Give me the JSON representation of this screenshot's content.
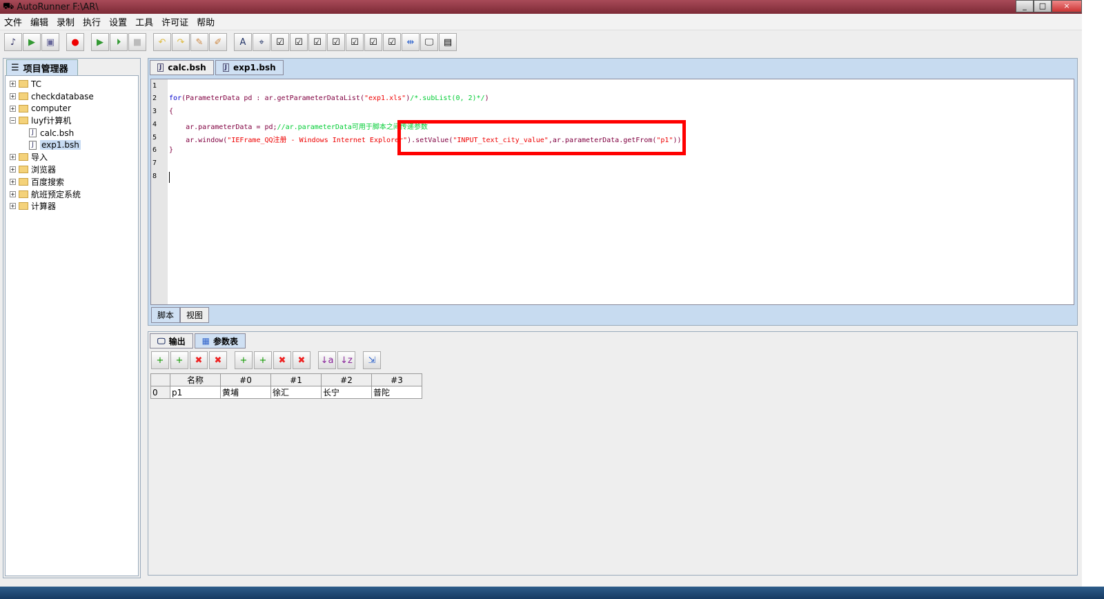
{
  "window": {
    "title": "AutoRunner  F:\\AR\\",
    "controls": [
      "_",
      "□",
      "×"
    ]
  },
  "menu": [
    "文件",
    "编辑",
    "录制",
    "执行",
    "设置",
    "工具",
    "许可证",
    "帮助"
  ],
  "toolbar_icons": [
    "new-script-icon",
    "import-icon",
    "save-icon",
    "record-icon",
    "run-icon",
    "run-step-icon",
    "stop-icon",
    "undo-icon",
    "redo-icon",
    "highlight-icon",
    "magic-icon",
    "text-icon",
    "object-icon",
    "check1-icon",
    "check2-icon",
    "check3-icon",
    "check4-icon",
    "check5-icon",
    "check6-icon",
    "check7-icon",
    "split-icon",
    "monitor-icon",
    "report-icon"
  ],
  "project": {
    "tab": "项目管理器",
    "tree": [
      {
        "label": "TC",
        "type": "folder",
        "exp": "+"
      },
      {
        "label": "checkdatabase",
        "type": "folder",
        "exp": "+"
      },
      {
        "label": "computer",
        "type": "folder",
        "exp": "+"
      },
      {
        "label": "luyf计算机",
        "type": "folder",
        "exp": "-"
      },
      {
        "label": "calc.bsh",
        "type": "file"
      },
      {
        "label": "exp1.bsh",
        "type": "file",
        "selected": true
      },
      {
        "label": "导入",
        "type": "folder",
        "exp": "+"
      },
      {
        "label": "浏览器",
        "type": "folder",
        "exp": "+"
      },
      {
        "label": "百度搜索",
        "type": "folder",
        "exp": "+"
      },
      {
        "label": "航班预定系统",
        "type": "folder",
        "exp": "+"
      },
      {
        "label": "计算器",
        "type": "folder",
        "exp": "+"
      }
    ]
  },
  "editor": {
    "tabs": [
      "calc.bsh",
      "exp1.bsh"
    ],
    "active_tab": "exp1.bsh",
    "line_numbers": [
      "1",
      "2",
      "3",
      "4",
      "5",
      "6",
      "7",
      "8"
    ],
    "code": {
      "l2a": "for",
      "l2b": "(ParameterData pd : ar.getParameterDataList(",
      "l2c": "\"exp1.xls\"",
      "l2d": ")",
      "l2e": "/*.subList(0, 2)*/",
      "l2f": ")",
      "l3": "{",
      "l4a": "    ar.parameterData = pd;",
      "l4b": "//ar.parameterData可用于脚本之间传递参数",
      "l5a": "    ar.window(",
      "l5b": "\"IEFrame_QQ注册 - Windows Internet Explorer\"",
      "l5c": ").setValue(",
      "l5d": "\"INPUT_text_city_value\"",
      "l5e": ",ar.parameterData.getFrom(",
      "l5f": "\"p1\"",
      "l5g": "));",
      "l6": "}"
    },
    "bottom_tabs": [
      "脚本",
      "视图"
    ]
  },
  "output": {
    "tabs": [
      "输出",
      "参数表"
    ],
    "active_tab": "参数表",
    "table": {
      "headers": [
        "",
        "名称",
        "#0",
        "#1",
        "#2",
        "#3"
      ],
      "rows": [
        [
          "0",
          "p1",
          "黄埔",
          "徐汇",
          "长宁",
          "普陀"
        ]
      ]
    }
  },
  "highlight_color": "#ff0000"
}
